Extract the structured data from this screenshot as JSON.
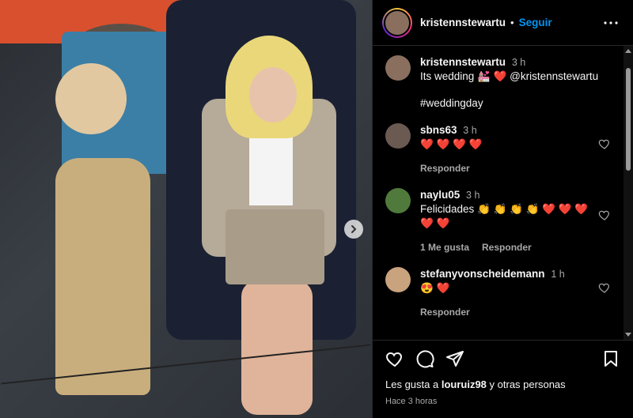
{
  "post": {
    "username": "kristennstewartu",
    "follow_label": "Seguir",
    "separator": "•"
  },
  "caption": {
    "username": "kristennstewartu",
    "time": "3 h",
    "text": "Its wedding 💒 ❤️ @kristennstewartu",
    "hashtag": "#weddingday"
  },
  "comments": [
    {
      "username": "sbns63",
      "time": "3 h",
      "text": "❤️ ❤️ ❤️ ❤️",
      "reply_label": "Responder",
      "likes_label": ""
    },
    {
      "username": "naylu05",
      "time": "3 h",
      "text": "Felicidades 👏 👏 👏 👏 ❤️ ❤️ ❤️ ❤️ ❤️",
      "reply_label": "Responder",
      "likes_label": "1 Me gusta"
    },
    {
      "username": "stefanyvonscheidemann",
      "time": "1 h",
      "text": "😍 ❤️",
      "reply_label": "Responder",
      "likes_label": ""
    }
  ],
  "footer": {
    "likes_prefix": "Les gusta a",
    "likes_user": "louruiz98",
    "likes_suffix": "y otras personas",
    "posted": "Hace 3 horas"
  },
  "icons": {
    "like": "heart-icon",
    "comment": "comment-icon",
    "share": "send-icon",
    "save": "bookmark-icon",
    "more": "more-icon",
    "next": "chevron-right-icon"
  },
  "colors": {
    "background": "#000000",
    "link": "#0095f6",
    "muted": "#a8a8a8"
  }
}
